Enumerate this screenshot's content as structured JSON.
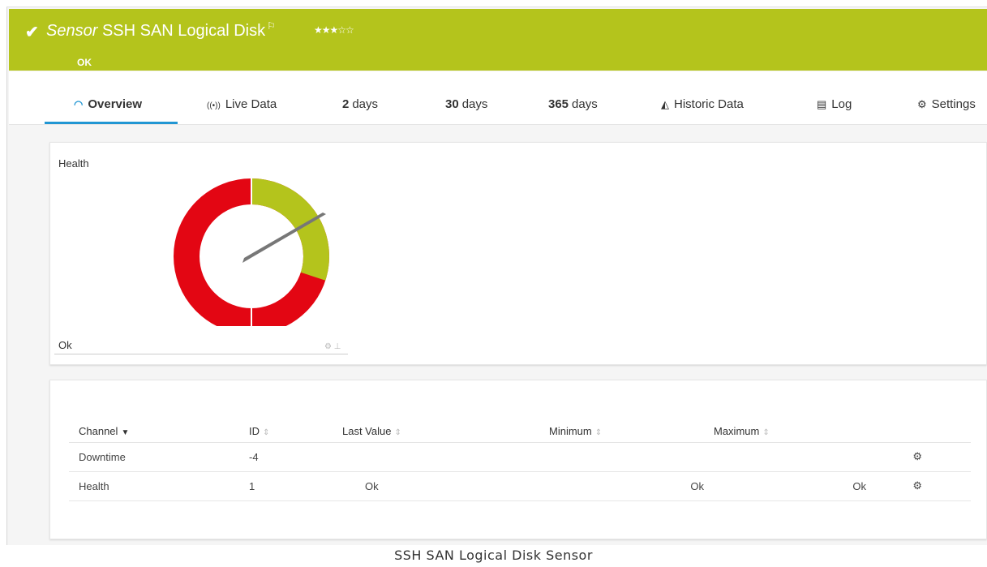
{
  "header": {
    "kind": "Sensor",
    "name": "SSH SAN Logical Disk",
    "status": "OK",
    "stars": "★★★☆☆",
    "color": "#b4c41c"
  },
  "tabs": [
    {
      "icon": "gauge-icon",
      "label": "Overview"
    },
    {
      "icon": "live-icon",
      "label": "Live Data"
    },
    {
      "num": "2",
      "label": "days"
    },
    {
      "num": "30",
      "label": "days"
    },
    {
      "num": "365",
      "label": "days"
    },
    {
      "icon": "chart-icon",
      "label": "Historic Data"
    },
    {
      "icon": "log-icon",
      "label": "Log"
    },
    {
      "icon": "gear-icon",
      "label": "Settings"
    }
  ],
  "health": {
    "title": "Health",
    "value": "Ok",
    "gauge_fraction_green": 0.3,
    "colors": {
      "ok": "#b4c41c",
      "error": "#e30613",
      "needle": "#777777"
    }
  },
  "table": {
    "columns": [
      "Channel",
      "ID",
      "Last Value",
      "Minimum",
      "Maximum"
    ],
    "rows": [
      {
        "channel": "Downtime",
        "id": "-4",
        "last": "",
        "min": "",
        "max": ""
      },
      {
        "channel": "Health",
        "id": "1",
        "last": "Ok",
        "min": "Ok",
        "max": "Ok"
      }
    ]
  },
  "caption": "SSH SAN Logical Disk Sensor"
}
